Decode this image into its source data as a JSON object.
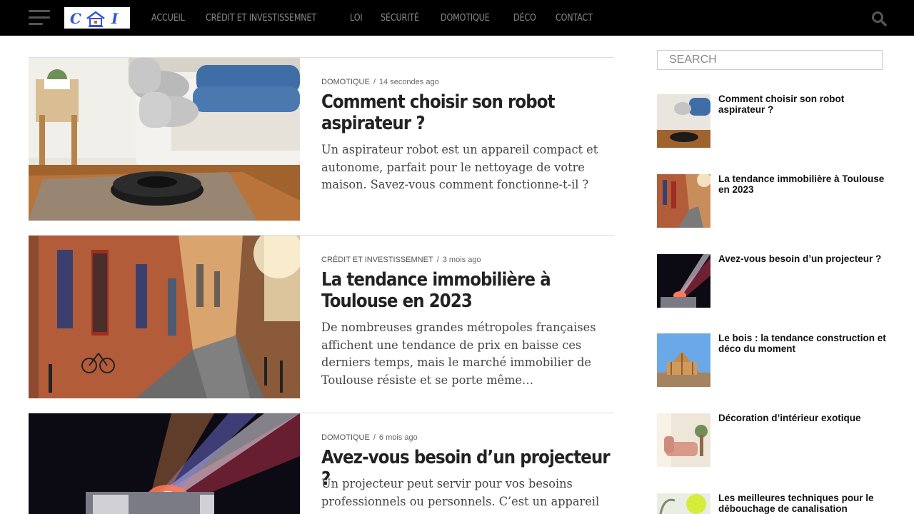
{
  "header": {
    "nav": [
      "Accueil",
      "Crédit et investissemnet",
      "Loi",
      "Sécurité",
      "Domotique",
      "Déco",
      "Contact"
    ],
    "logo_text": "CⒶI"
  },
  "articles": [
    {
      "category": "Domotique",
      "time": "14 secondes ago",
      "title": "Comment choisir son robot aspirateur ?",
      "excerpt": "Un aspirateur robot est un appareil compact et autonome, parfait pour le nettoyage de votre maison. Savez-vous comment fonctionne-t-il ?"
    },
    {
      "category": "Crédit et investissemnet",
      "time": "3 mois ago",
      "title": "La tendance immobilière à Toulouse en 2023",
      "excerpt": "De nombreuses grandes métropoles françaises affichent une tendance de prix en baisse ces derniers temps, mais le marché immobilier de Toulouse résiste et se porte même…"
    },
    {
      "category": "Domotique",
      "time": "6 mois ago",
      "title": "Avez-vous besoin d’un projecteur ?",
      "excerpt": "Un projecteur peut servir pour vos besoins professionnels ou personnels. C’est un appareil"
    }
  ],
  "sidebar": {
    "search_placeholder": "SEARCH",
    "items": [
      "Comment choisir son robot aspirateur ?",
      "La tendance immobilière à Toulouse en 2023",
      "Avez-vous besoin d’un projecteur ?",
      "Le bois : la tendance construction et déco du moment",
      "Décoration d’intérieur exotique",
      "Les meilleures techniques pour le débouchage de canalisation"
    ]
  }
}
